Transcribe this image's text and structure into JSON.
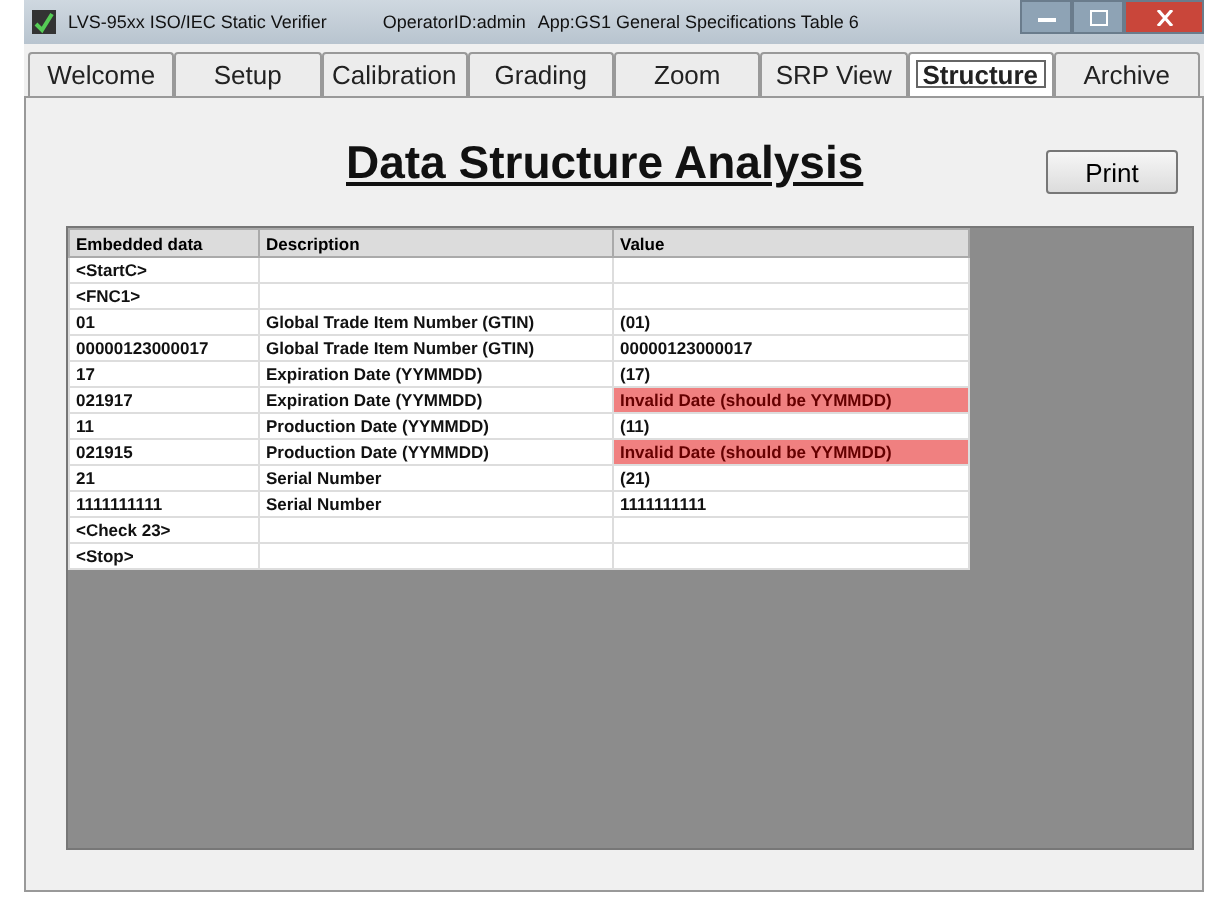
{
  "window": {
    "title": "LVS-95xx ISO/IEC Static Verifier",
    "operator": "OperatorID:admin",
    "app": "App:GS1 General Specifications Table 6"
  },
  "tabs": [
    {
      "label": "Welcome",
      "selected": false
    },
    {
      "label": "Setup",
      "selected": false
    },
    {
      "label": "Calibration",
      "selected": false
    },
    {
      "label": "Grading",
      "selected": false
    },
    {
      "label": "Zoom",
      "selected": false
    },
    {
      "label": "SRP View",
      "selected": false
    },
    {
      "label": "Structure",
      "selected": true
    },
    {
      "label": "Archive",
      "selected": false
    }
  ],
  "heading": "Data Structure Analysis",
  "print_button": "Print",
  "table": {
    "columns": [
      "Embedded data",
      "Description",
      "Value"
    ],
    "rows": [
      {
        "cells": [
          "<StartC>",
          "",
          ""
        ],
        "invalid": false
      },
      {
        "cells": [
          "<FNC1>",
          "",
          ""
        ],
        "invalid": false
      },
      {
        "cells": [
          "01",
          "Global Trade Item Number (GTIN)",
          "(01)"
        ],
        "invalid": false
      },
      {
        "cells": [
          "00000123000017",
          "Global Trade Item Number (GTIN)",
          "00000123000017"
        ],
        "invalid": false
      },
      {
        "cells": [
          "17",
          "Expiration Date (YYMMDD)",
          "(17)"
        ],
        "invalid": false
      },
      {
        "cells": [
          "021917",
          "Expiration Date (YYMMDD)",
          "Invalid Date (should be YYMMDD)"
        ],
        "invalid": true
      },
      {
        "cells": [
          "11",
          "Production Date (YYMMDD)",
          "(11)"
        ],
        "invalid": false
      },
      {
        "cells": [
          "021915",
          "Production Date (YYMMDD)",
          "Invalid Date (should be YYMMDD)"
        ],
        "invalid": true
      },
      {
        "cells": [
          "21",
          "Serial Number",
          "(21)"
        ],
        "invalid": false
      },
      {
        "cells": [
          "1111111111",
          "Serial Number",
          "1111111111"
        ],
        "invalid": false
      },
      {
        "cells": [
          "<Check 23>",
          "",
          ""
        ],
        "invalid": false
      },
      {
        "cells": [
          "<Stop>",
          "",
          ""
        ],
        "invalid": false
      }
    ]
  }
}
